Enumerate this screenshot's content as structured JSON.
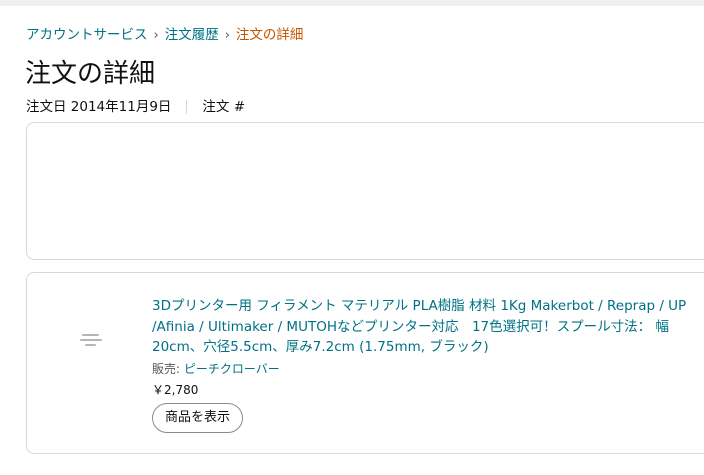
{
  "breadcrumb": {
    "items": [
      "アカウントサービス",
      "注文履歴"
    ],
    "separator": "›",
    "current": "注文の詳細"
  },
  "page_title": "注文の詳細",
  "order": {
    "date_text": "注文日 2014年11月9日",
    "number_label": "注文 #"
  },
  "item": {
    "title": "3Dプリンター用 フィラメント マテリアル PLA樹脂 材料 1Kg Makerbot / Reprap / UP /Afinia / Ultimaker / MUTOHなどプリンター対応　17色選択可！スプール寸法： 幅20cm、穴径5.5cm、厚み7.2cm (1.75mm, ブラック)",
    "seller_label": "販売: ",
    "seller_name": "ピーチクローバー",
    "price": "￥2,780",
    "view_button": "商品を表示"
  },
  "colors": {
    "link": "#007185",
    "current_crumb": "#c45500",
    "border": "#d5d9d9"
  }
}
